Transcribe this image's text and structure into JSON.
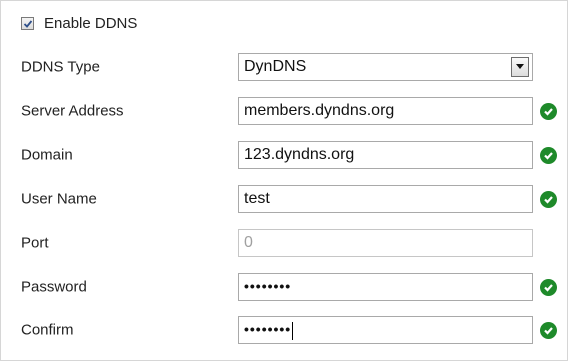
{
  "enable_ddns": {
    "label": "Enable DDNS",
    "checked": true
  },
  "fields": {
    "ddns_type": {
      "label": "DDNS Type",
      "value": "DynDNS",
      "options": [
        "DynDNS"
      ]
    },
    "server_address": {
      "label": "Server Address",
      "value": "members.dyndns.org",
      "valid": true
    },
    "domain": {
      "label": "Domain",
      "value": "123.dyndns.org",
      "valid": true
    },
    "user_name": {
      "label": "User Name",
      "value": "test",
      "valid": true
    },
    "port": {
      "label": "Port",
      "value": "0",
      "disabled": true
    },
    "password": {
      "label": "Password",
      "value": "••••••••",
      "valid": true
    },
    "confirm": {
      "label": "Confirm",
      "value": "••••••••",
      "valid": true
    }
  },
  "icons": {
    "valid": "check-circle-icon",
    "dropdown": "chevron-down-icon",
    "checkbox": "checkmark-icon"
  },
  "colors": {
    "valid_green": "#1e8a2a",
    "border": "#a9a9a9",
    "disabled_text": "#a0a0a0"
  }
}
